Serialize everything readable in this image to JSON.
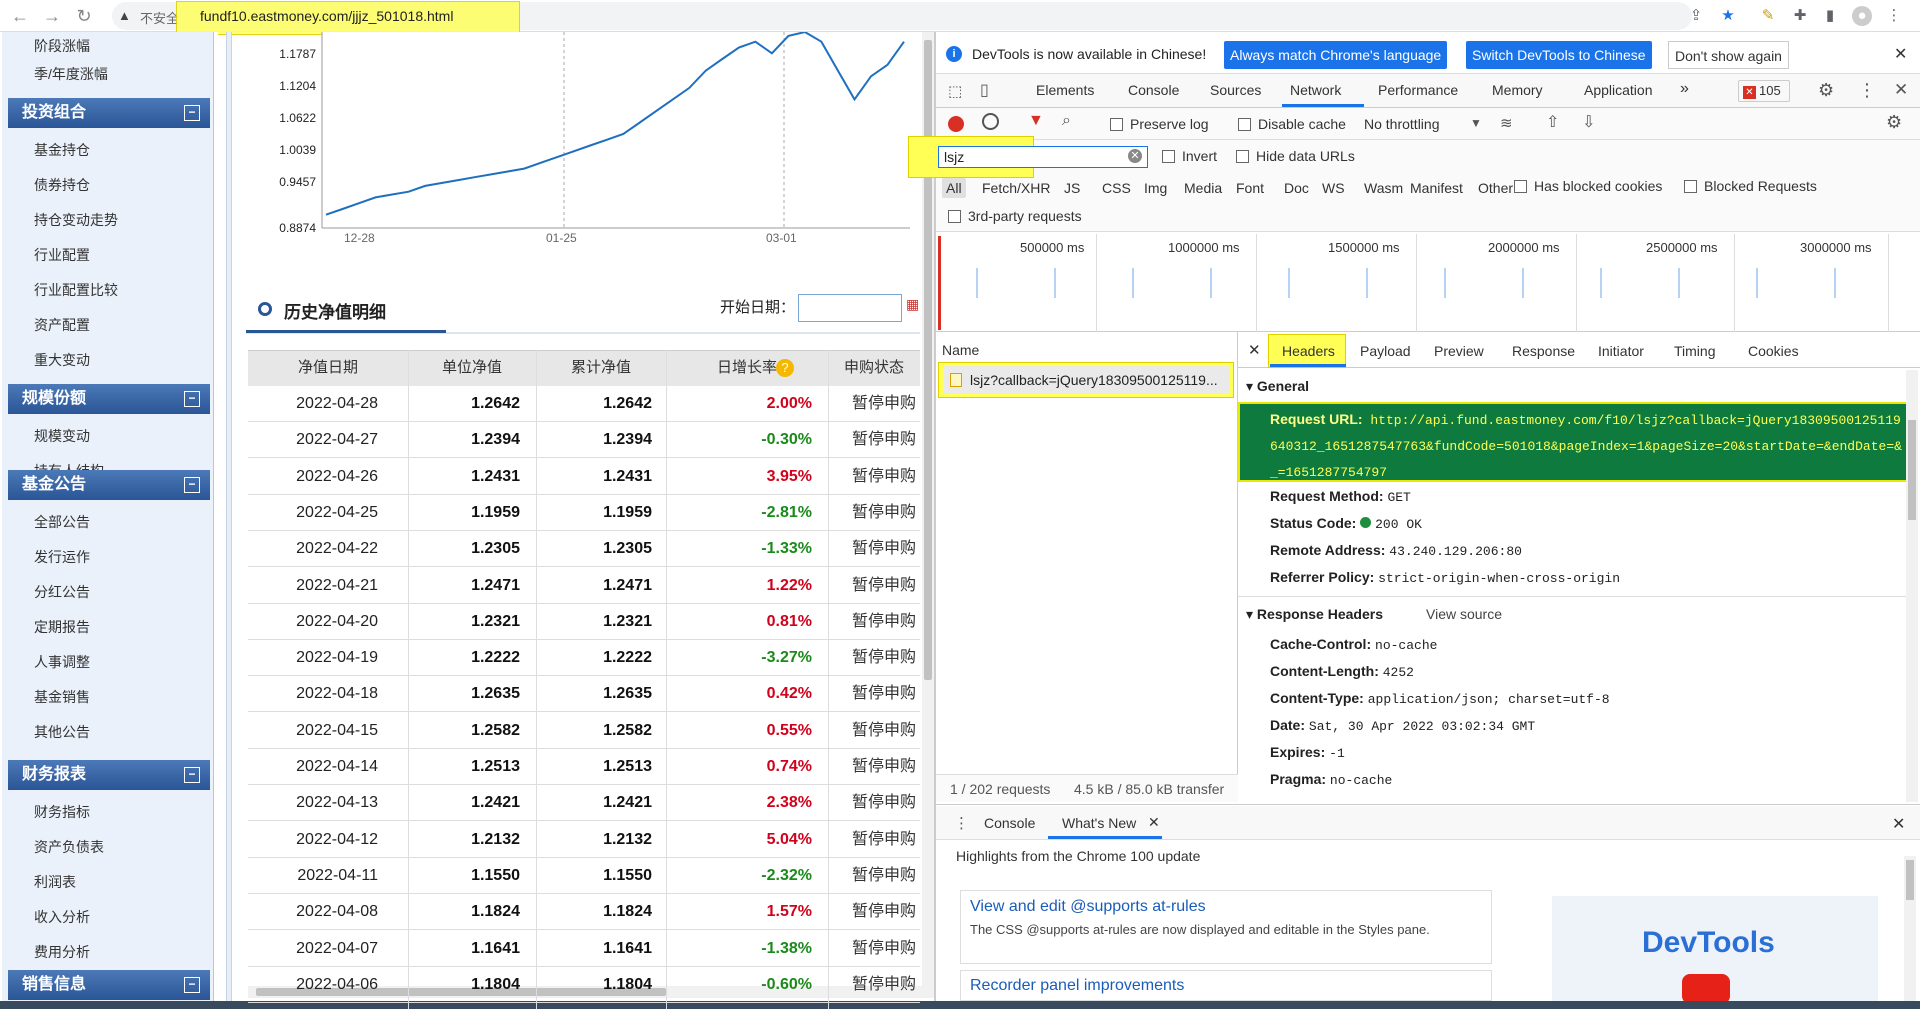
{
  "browser": {
    "insecure_label": "不安全",
    "url": "fundf10.eastmoney.com/jjjz_501018.html"
  },
  "sidebar": {
    "top_items": [
      "阶段涨幅",
      "季/年度涨幅"
    ],
    "sections": [
      {
        "title": "投资组合",
        "items": [
          "基金持仓",
          "债券持仓",
          "持仓变动走势",
          "行业配置",
          "行业配置比较",
          "资产配置",
          "重大变动"
        ]
      },
      {
        "title": "规模份额",
        "items": [
          "规模变动",
          "持有人结构"
        ]
      },
      {
        "title": "基金公告",
        "items": [
          "全部公告",
          "发行运作",
          "分红公告",
          "定期报告",
          "人事调整",
          "基金销售",
          "其他公告"
        ]
      },
      {
        "title": "财务报表",
        "items": [
          "财务指标",
          "资产负债表",
          "利润表",
          "收入分析",
          "费用分析"
        ]
      },
      {
        "title": "销售信息",
        "items": []
      }
    ],
    "collapse_symbol": "−"
  },
  "chart_data": {
    "type": "line",
    "y_ticks": [
      "1.1787",
      "1.1204",
      "1.0622",
      "1.0039",
      "0.9457",
      "0.8874"
    ],
    "x_ticks": [
      "12-28",
      "01-25",
      "03-01"
    ],
    "ylim": [
      0.8874,
      1.1787
    ],
    "series": [
      {
        "values": [
          0.9,
          0.91,
          0.92,
          0.93,
          0.935,
          0.94,
          0.95,
          0.955,
          0.96,
          0.965,
          0.97,
          0.975,
          0.98,
          0.99,
          1.0,
          1.01,
          1.02,
          1.03,
          1.04,
          1.06,
          1.08,
          1.1,
          1.12,
          1.15,
          1.17,
          1.19,
          1.2,
          1.18,
          1.21,
          1.23,
          1.2,
          1.15,
          1.1,
          1.14,
          1.16,
          1.2
        ]
      }
    ]
  },
  "history": {
    "title": "历史净值明细",
    "start_date_label": "开始日期：",
    "columns": [
      "净值日期",
      "单位净值",
      "累计净值",
      "日增长率",
      "申购状态"
    ],
    "rows": [
      {
        "date": "2022-04-28",
        "nav": "1.2642",
        "acc": "1.2642",
        "rate": "2.00%",
        "status": "暂停申购",
        "up": true
      },
      {
        "date": "2022-04-27",
        "nav": "1.2394",
        "acc": "1.2394",
        "rate": "-0.30%",
        "status": "暂停申购",
        "up": false
      },
      {
        "date": "2022-04-26",
        "nav": "1.2431",
        "acc": "1.2431",
        "rate": "3.95%",
        "status": "暂停申购",
        "up": true
      },
      {
        "date": "2022-04-25",
        "nav": "1.1959",
        "acc": "1.1959",
        "rate": "-2.81%",
        "status": "暂停申购",
        "up": false
      },
      {
        "date": "2022-04-22",
        "nav": "1.2305",
        "acc": "1.2305",
        "rate": "-1.33%",
        "status": "暂停申购",
        "up": false
      },
      {
        "date": "2022-04-21",
        "nav": "1.2471",
        "acc": "1.2471",
        "rate": "1.22%",
        "status": "暂停申购",
        "up": true
      },
      {
        "date": "2022-04-20",
        "nav": "1.2321",
        "acc": "1.2321",
        "rate": "0.81%",
        "status": "暂停申购",
        "up": true
      },
      {
        "date": "2022-04-19",
        "nav": "1.2222",
        "acc": "1.2222",
        "rate": "-3.27%",
        "status": "暂停申购",
        "up": false
      },
      {
        "date": "2022-04-18",
        "nav": "1.2635",
        "acc": "1.2635",
        "rate": "0.42%",
        "status": "暂停申购",
        "up": true
      },
      {
        "date": "2022-04-15",
        "nav": "1.2582",
        "acc": "1.2582",
        "rate": "0.55%",
        "status": "暂停申购",
        "up": true
      },
      {
        "date": "2022-04-14",
        "nav": "1.2513",
        "acc": "1.2513",
        "rate": "0.74%",
        "status": "暂停申购",
        "up": true
      },
      {
        "date": "2022-04-13",
        "nav": "1.2421",
        "acc": "1.2421",
        "rate": "2.38%",
        "status": "暂停申购",
        "up": true
      },
      {
        "date": "2022-04-12",
        "nav": "1.2132",
        "acc": "1.2132",
        "rate": "5.04%",
        "status": "暂停申购",
        "up": true
      },
      {
        "date": "2022-04-11",
        "nav": "1.1550",
        "acc": "1.1550",
        "rate": "-2.32%",
        "status": "暂停申购",
        "up": false
      },
      {
        "date": "2022-04-08",
        "nav": "1.1824",
        "acc": "1.1824",
        "rate": "1.57%",
        "status": "暂停申购",
        "up": true
      },
      {
        "date": "2022-04-07",
        "nav": "1.1641",
        "acc": "1.1641",
        "rate": "-1.38%",
        "status": "暂停申购",
        "up": false
      },
      {
        "date": "2022-04-06",
        "nav": "1.1804",
        "acc": "1.1804",
        "rate": "-0.60%",
        "status": "暂停申购",
        "up": false
      }
    ]
  },
  "devtools": {
    "info_text": "DevTools is now available in Chinese!",
    "btn_match": "Always match Chrome's language",
    "btn_switch": "Switch DevTools to Chinese",
    "btn_dont_show": "Don't show again",
    "tabs": [
      "Elements",
      "Console",
      "Sources",
      "Network",
      "Performance",
      "Memory",
      "Application"
    ],
    "error_count": "105",
    "preserve_log": "Preserve log",
    "disable_cache": "Disable cache",
    "throttling": "No throttling",
    "filter_value": "lsjz",
    "invert": "Invert",
    "hide_data_urls": "Hide data URLs",
    "filter_types": [
      "All",
      "Fetch/XHR",
      "JS",
      "CSS",
      "Img",
      "Media",
      "Font",
      "Doc",
      "WS",
      "Wasm",
      "Manifest",
      "Other"
    ],
    "has_blocked_cookies": "Has blocked cookies",
    "blocked_requests": "Blocked Requests",
    "third_party": "3rd-party requests",
    "timeline_labels": [
      "500000 ms",
      "1000000 ms",
      "1500000 ms",
      "2000000 ms",
      "2500000 ms",
      "3000000 ms"
    ],
    "name_header": "Name",
    "request_name": "lsjz?callback=jQuery18309500125119...",
    "requests_count": "1 / 202 requests",
    "transfer": "4.5 kB / 85.0 kB transfer",
    "detail_tabs": [
      "Headers",
      "Payload",
      "Preview",
      "Response",
      "Initiator",
      "Timing",
      "Cookies"
    ],
    "general": "General",
    "request_url_label": "Request URL:",
    "request_url": "http://api.fund.eastmoney.com/f10/lsjz?callback=jQuery18309500125119640312_1651287547763&fundCode=501018&pageIndex=1&pageSize=20&startDate=&endDate=&_=1651287754797",
    "request_method_label": "Request Method:",
    "request_method": "GET",
    "status_code_label": "Status Code:",
    "status_code": "200 OK",
    "remote_address_label": "Remote Address:",
    "remote_address": "43.240.129.206:80",
    "referrer_policy_label": "Referrer Policy:",
    "referrer_policy": "strict-origin-when-cross-origin",
    "response_headers": "Response Headers",
    "view_source": "View source",
    "resp": [
      {
        "k": "Cache-Control:",
        "v": "no-cache"
      },
      {
        "k": "Content-Length:",
        "v": "4252"
      },
      {
        "k": "Content-Type:",
        "v": "application/json; charset=utf-8"
      },
      {
        "k": "Date:",
        "v": "Sat, 30 Apr 2022 03:02:34 GMT"
      },
      {
        "k": "Expires:",
        "v": "-1"
      },
      {
        "k": "Pragma:",
        "v": "no-cache"
      }
    ],
    "drawer_console": "Console",
    "drawer_whatsnew": "What's New",
    "highlights": "Highlights from the Chrome 100 update",
    "card1_title": "View and edit @supports at-rules",
    "card1_desc": "The CSS @supports at-rules are now displayed and editable in the Styles pane.",
    "card2_title": "Recorder panel improvements",
    "logo_text": "DevTools"
  },
  "colors": {
    "up": "#d0021b",
    "down": "#1a8a1a",
    "accent": "#1a73e8",
    "highlight": "#ffff55"
  }
}
